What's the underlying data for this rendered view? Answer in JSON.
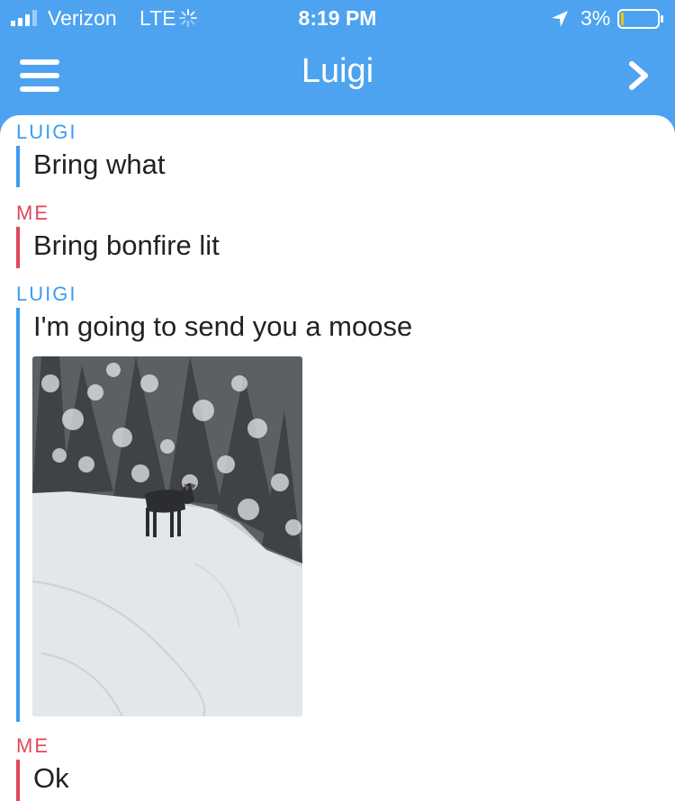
{
  "status_bar": {
    "carrier": "Verizon",
    "network": "LTE",
    "time": "8:19 PM",
    "battery_percent": "3%"
  },
  "nav": {
    "title": "Luigi",
    "menu_icon": "hamburger-menu-icon",
    "forward_icon": "chevron-right-icon"
  },
  "colors": {
    "header_blue": "#4da3ef",
    "friend_blue": "#3d9df0",
    "me_red": "#e0475b"
  },
  "messages": [
    {
      "sender": "LUIGI",
      "text": "Bring what"
    },
    {
      "sender": "ME",
      "text": "Bring bonfire lit"
    },
    {
      "sender": "LUIGI",
      "text": "I'm going to send you a moose"
    },
    {
      "sender": "ME",
      "text": "Ok"
    }
  ]
}
